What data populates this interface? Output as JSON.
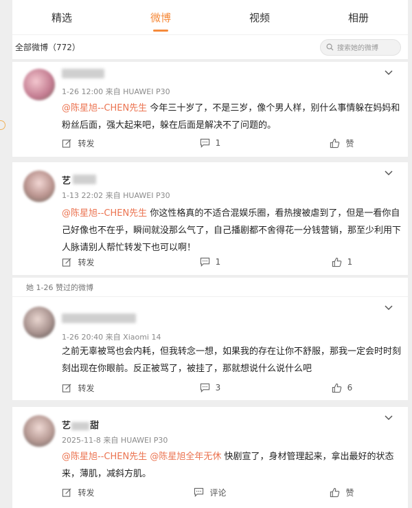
{
  "tabs": [
    "精选",
    "微博",
    "视频",
    "相册"
  ],
  "active_tab": "微博",
  "weibo_count": "全部微博（772）",
  "search_placeholder": "搜索她的微博",
  "posts": [
    {
      "name": "",
      "meta": "1-26 12:00  来自 HUAWEI P30",
      "mentions": [
        "@陈星旭--CHEN先生"
      ],
      "text": " 今年三十岁了，不是三岁，像个男人样，别什么事情躲在妈妈和粉丝后面，强大起来吧，躲在后面是解决不了问题的。",
      "repost": "转发",
      "comment": "1",
      "like": "赞"
    },
    {
      "name": "艺",
      "meta": "1-13 22:02  来自 HUAWEI P30",
      "mentions": [
        "@陈星旭--CHEN先生"
      ],
      "text": " 你这性格真的不适合混娱乐圈，看热搜被虐到了，但是一看你自己好像也不在乎，瞬间就没那么气了，自己播剧都不舍得花一分钱营销，那至少利用下人脉请别人帮忙转发下也可以啊！",
      "repost": "转发",
      "comment": "1",
      "like": "1"
    },
    {
      "liked_label": "她 1-26 赞过的微博",
      "name": "",
      "meta": "1-26 20:40  来自 Xiaomi 14",
      "mentions": [],
      "text": "之前无辜被骂也会内耗，但我转念一想，如果我的存在让你不舒服，那我一定会时时刻刻出现在你眼前。反正被骂了，被挂了，那就想说什么说什么吧",
      "repost": "转发",
      "comment": "3",
      "like": "6"
    },
    {
      "name": "艺",
      "name_suffix": "甜",
      "meta": "2025-11-8  来自 HUAWEI P30",
      "mentions": [
        "@陈星旭--CHEN先生",
        "@陈星旭全年无休"
      ],
      "text": " 快剧宣了，身材管理起来，拿出最好的状态来，薄肌，减斜方肌。",
      "repost": "转发",
      "comment": "评论",
      "like": "赞"
    }
  ],
  "colors": {
    "accent": "#f58a3b",
    "mention": "#eb7350"
  }
}
